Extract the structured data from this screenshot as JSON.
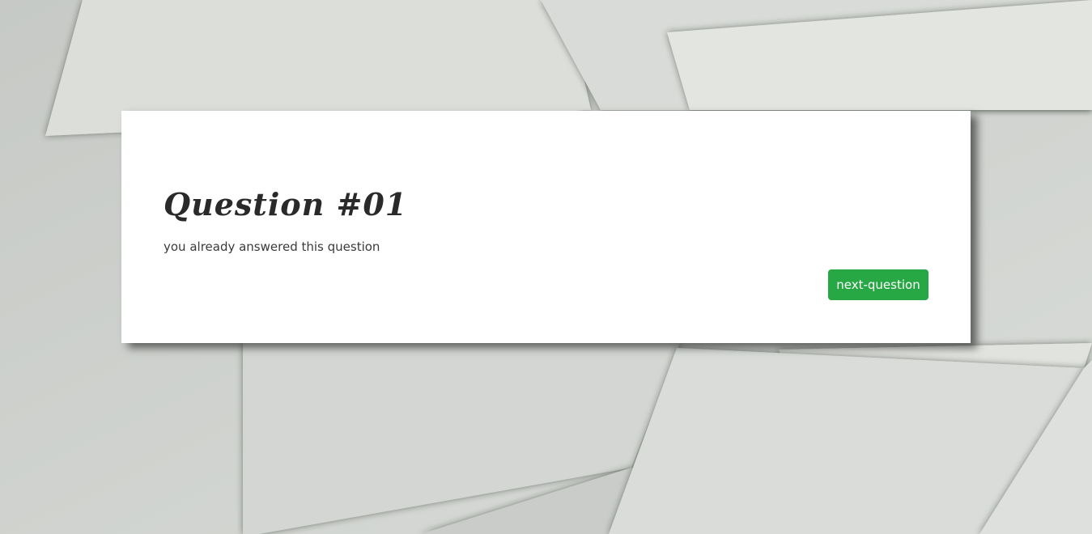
{
  "card": {
    "title": "Question #01",
    "status_message": "you already answered this question",
    "next_button_label": "next-question"
  },
  "colors": {
    "button_background": "#28a745",
    "card_background": "#ffffff"
  }
}
